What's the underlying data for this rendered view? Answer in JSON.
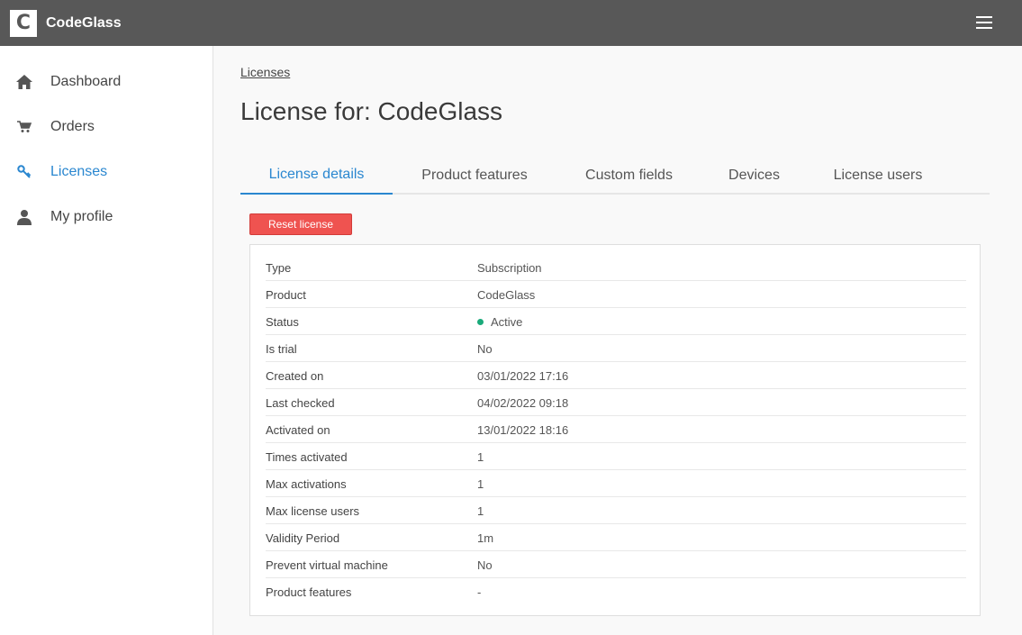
{
  "app": {
    "logo_letter": "C",
    "name": "CodeGlass"
  },
  "sidebar": {
    "items": [
      {
        "label": "Dashboard",
        "icon": "home-icon"
      },
      {
        "label": "Orders",
        "icon": "cart-icon"
      },
      {
        "label": "Licenses",
        "icon": "key-icon",
        "active": true
      },
      {
        "label": "My profile",
        "icon": "user-icon"
      }
    ]
  },
  "breadcrumb": "Licenses",
  "page_title": "License for: CodeGlass",
  "tabs": [
    {
      "label": "License details",
      "active": true
    },
    {
      "label": "Product features"
    },
    {
      "label": "Custom fields"
    },
    {
      "label": "Devices"
    },
    {
      "label": "License users"
    }
  ],
  "reset_button": "Reset license",
  "details": [
    {
      "key": "Type",
      "value": "Subscription"
    },
    {
      "key": "Product",
      "value": "CodeGlass"
    },
    {
      "key": "Status",
      "value": "Active"
    },
    {
      "key": "Is trial",
      "value": "No"
    },
    {
      "key": "Created on",
      "value": "03/01/2022 17:16"
    },
    {
      "key": "Last checked",
      "value": "04/02/2022 09:18"
    },
    {
      "key": "Activated on",
      "value": "13/01/2022 18:16"
    },
    {
      "key": "Times activated",
      "value": "1"
    },
    {
      "key": "Max activations",
      "value": "1"
    },
    {
      "key": "Max license users",
      "value": "1"
    },
    {
      "key": "Validity Period",
      "value": "1m"
    },
    {
      "key": "Prevent virtual machine",
      "value": "No"
    },
    {
      "key": "Product features",
      "value": "-"
    }
  ],
  "colors": {
    "topbar": "#585858",
    "accent": "#2a87d0",
    "danger": "#ef5350",
    "status_active": "#1aaa7a"
  }
}
